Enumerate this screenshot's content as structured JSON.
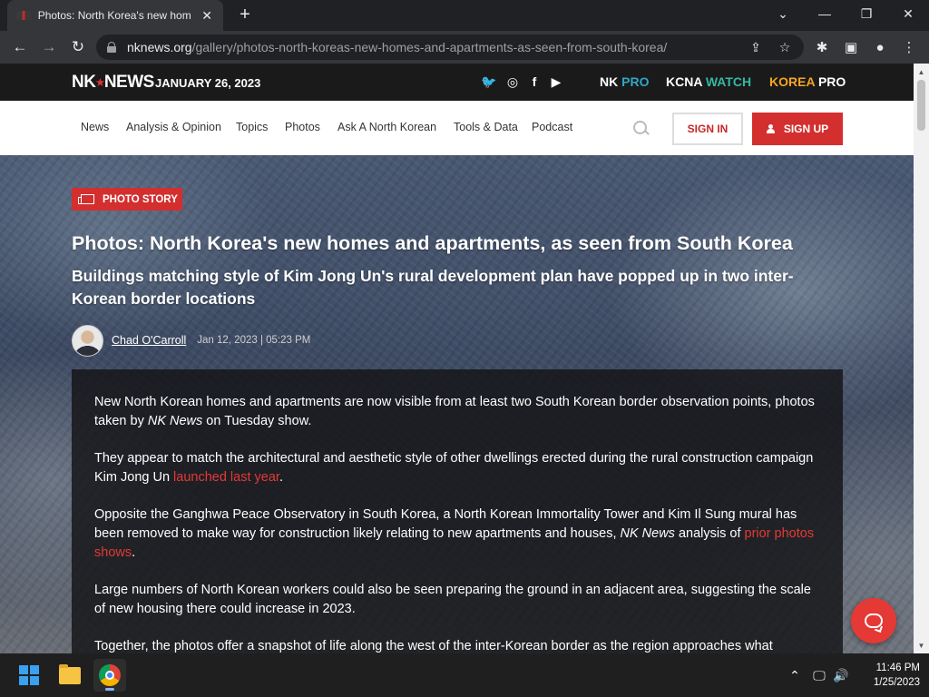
{
  "browser": {
    "tab_title": "Photos: North Korea's new homes and apartments, as seen from South Korea - NK News",
    "tab_close": "✕",
    "new_tab": "+",
    "minimize": "—",
    "maximize": "❐",
    "close": "✕",
    "collapse": "⌄",
    "back": "←",
    "forward": "→",
    "reload": "↻",
    "url_host": "nknews.org",
    "url_path": "/gallery/photos-north-koreas-new-homes-and-apartments-as-seen-from-south-korea/",
    "icons": [
      "lock-icon",
      "share-icon",
      "star-icon",
      "extensions-icon",
      "sidepanel-icon",
      "profile-icon",
      "menu-icon"
    ]
  },
  "site": {
    "logo_left": "NK",
    "logo_dot": "★",
    "logo_right": "NEWS",
    "date": "JANUARY 26, 2023",
    "social": {
      "twitter": "🐦",
      "instagram": "◎",
      "facebook": "f",
      "youtube": "▶"
    },
    "brands": [
      {
        "a": "NK",
        "b": "PRO",
        "a_color": "#ffffff",
        "b_color": "#2fa8c8"
      },
      {
        "a": "KCNA",
        "b": "WATCH",
        "a_color": "#ffffff",
        "b_color": "#35b8a0"
      },
      {
        "a": "KOREA",
        "b": "PRO",
        "a_color": "#f5a623",
        "b_color": "#ffffff"
      }
    ],
    "nav": [
      "News",
      "Analysis & Opinion",
      "Topics",
      "Photos",
      "Ask A North Korean",
      "Tools & Data",
      "Podcast"
    ],
    "sign_in": "SIGN IN",
    "sign_up": "SIGN UP"
  },
  "article": {
    "badge": "PHOTO STORY",
    "headline": "Photos: North Korea's new homes and apartments, as seen from South Korea",
    "subheadline": "Buildings matching style of Kim Jong Un's rural development plan have popped up in two inter-Korean border locations",
    "author": "Chad O'Carroll",
    "meta": "Jan 12, 2023 | 05:23 PM",
    "p1a": "New North Korean homes and apartments are now visible from at least two South Korean border observation points, photos taken by ",
    "p1em": "NK News",
    "p1b": " on Tuesday show.",
    "p2a": "They appear to match the architectural and aesthetic style of other dwellings erected during the rural construction campaign Kim Jong Un ",
    "p2link": "launched last year",
    "p2b": ".",
    "p3a": "Opposite the Ganghwa Peace Observatory in South Korea, a North Korean Immortality Tower and Kim Il Sung mural has been removed to make way for construction likely relating to new apartments and houses, ",
    "p3em": "NK News",
    "p3b": " analysis of ",
    "p3link": "prior photos shows",
    "p3c": ".",
    "p4": "Large numbers of North Korean workers could also be seen preparing the ground in an adjacent area, suggesting the scale of new housing there could increase in 2023.",
    "p5": "Together, the photos offer a snapshot of life along the west of the inter-Korean border as the region approaches what"
  },
  "taskbar": {
    "time": "11:46 PM",
    "date": "1/25/2023",
    "tray": {
      "chevron": "⌃",
      "network": "🖵",
      "volume": "🔊"
    }
  }
}
